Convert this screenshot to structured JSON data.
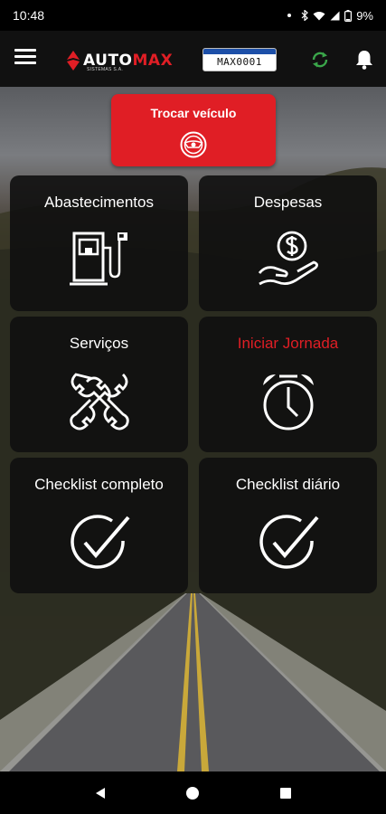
{
  "status_bar": {
    "time": "10:48",
    "battery": "9%",
    "icons": [
      "dot-icon",
      "bluetooth-icon",
      "wifi-icon",
      "signal-icon",
      "battery-icon"
    ]
  },
  "app_bar": {
    "logo_a": "AUTO",
    "logo_b": "MAX",
    "logo_sub": "SISTEMAS S.A.",
    "plate": "MAX0001"
  },
  "switch_vehicle": {
    "label": "Trocar veículo",
    "icon": "steering-wheel-icon"
  },
  "tiles": [
    {
      "label": "Abastecimentos",
      "icon": "fuel-pump-icon"
    },
    {
      "label": "Despesas",
      "icon": "money-hand-icon"
    },
    {
      "label": "Serviços",
      "icon": "wrenches-icon"
    },
    {
      "label": "Iniciar Jornada",
      "icon": "alarm-clock-icon"
    },
    {
      "label": "Checklist completo",
      "icon": "check-circle-icon"
    },
    {
      "label": "Checklist diário",
      "icon": "check-circle-icon"
    }
  ],
  "colors": {
    "accent": "#e01e25",
    "tile_bg": "#101010",
    "app_bar_bg": "#111111",
    "sync_green": "#3aa64a"
  },
  "nav_bar": {
    "icons": [
      "back-icon",
      "home-icon",
      "recents-icon"
    ]
  }
}
